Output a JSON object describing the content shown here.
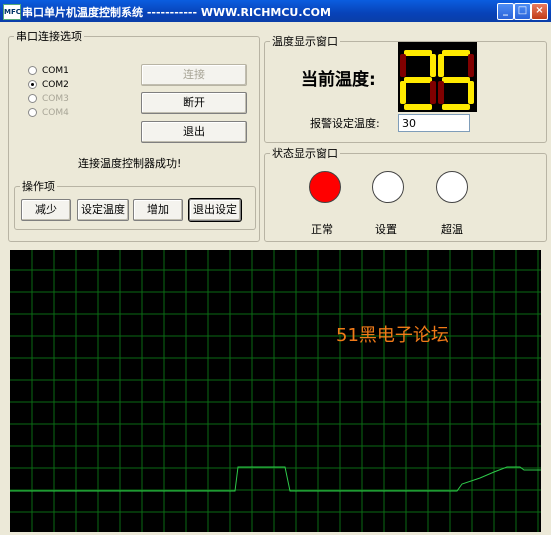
{
  "window": {
    "title": "串口单片机温度控制系统 ----------- WWW.RICHMCU.COM",
    "app_icon": "MFC",
    "controls": {
      "minimize": "_",
      "maximize": "□",
      "close": "×"
    }
  },
  "serial_group": {
    "legend": "串口连接选项",
    "ports": [
      {
        "label": "COM1",
        "selected": false,
        "enabled": true
      },
      {
        "label": "COM2",
        "selected": true,
        "enabled": true
      },
      {
        "label": "COM3",
        "selected": false,
        "enabled": false
      },
      {
        "label": "COM4",
        "selected": false,
        "enabled": false
      }
    ],
    "connect_label": "连接",
    "disconnect_label": "断开",
    "exit_label": "退出",
    "status": "连接温度控制器成功!"
  },
  "ops_group": {
    "legend": "操作项",
    "buttons": [
      "减少",
      "设定温度",
      "增加",
      "退出设定"
    ]
  },
  "temp_group": {
    "legend": "温度显示窗口",
    "label": "当前温度:",
    "display_value": "25",
    "alarm_label": "报警设定温度:",
    "alarm_value": "30",
    "segment_on_color": "#ffea00",
    "segment_off_color": "#800000"
  },
  "status_group": {
    "legend": "状态显示窗口",
    "lamps": [
      {
        "label": "正常",
        "color": "#ff0000"
      },
      {
        "label": "设置",
        "color": "#ffffff"
      },
      {
        "label": "超温",
        "color": "#ffffff"
      }
    ]
  },
  "graph": {
    "watermark": "51黑电子论坛",
    "grid_color": "#0a6a14",
    "trace_color": "#2ec94a",
    "background": "#000000"
  }
}
